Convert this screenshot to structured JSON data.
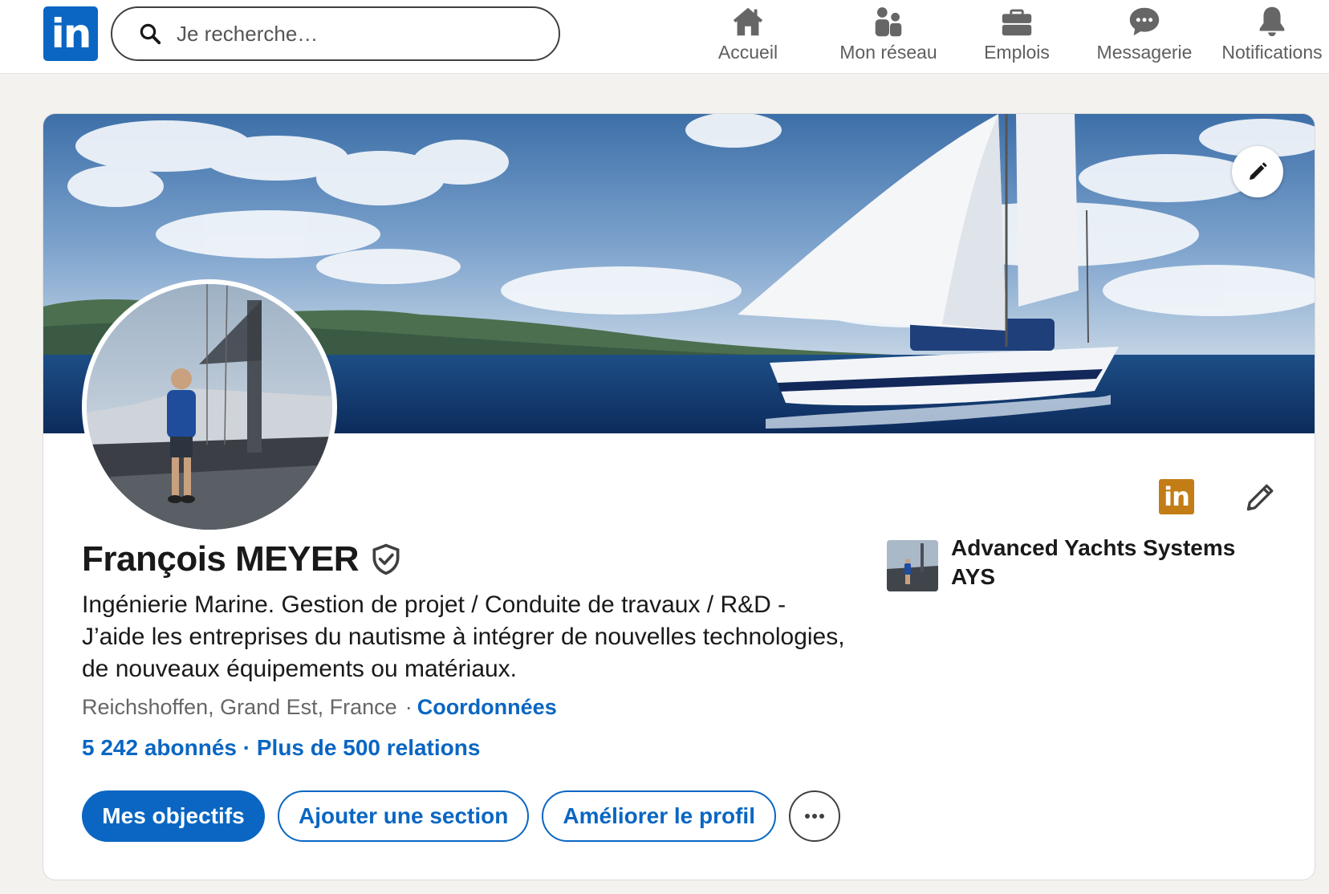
{
  "nav": {
    "logo_text": "in",
    "search_placeholder": "Je recherche…",
    "items": [
      {
        "label": "Accueil",
        "icon": "home-icon"
      },
      {
        "label": "Mon réseau",
        "icon": "network-icon"
      },
      {
        "label": "Emplois",
        "icon": "briefcase-icon"
      },
      {
        "label": "Messagerie",
        "icon": "message-icon"
      },
      {
        "label": "Notifications",
        "icon": "bell-icon"
      }
    ]
  },
  "profile": {
    "name": "François MEYER",
    "headline": "Ingénierie Marine. Gestion de projet / Conduite de travaux / R&D - J’aide les entreprises du nautisme à intégrer de nouvelles technologies, de nouveaux équipements ou matériaux.",
    "location": "Reichshoffen, Grand Est, France",
    "location_separator": "·",
    "contact_link": "Coordonnées",
    "followers": "5 242 abonnés",
    "stats_separator": "·",
    "connections": "Plus de 500 relations",
    "badge_text": "in",
    "company": "Advanced Yachts Systems AYS"
  },
  "actions": {
    "goals": "Mes objectifs",
    "add_section": "Ajouter une section",
    "improve": "Améliorer le profil"
  },
  "colors": {
    "brand": "#0a66c2",
    "badge": "#c37d16",
    "page_bg": "#f3f2ef"
  }
}
